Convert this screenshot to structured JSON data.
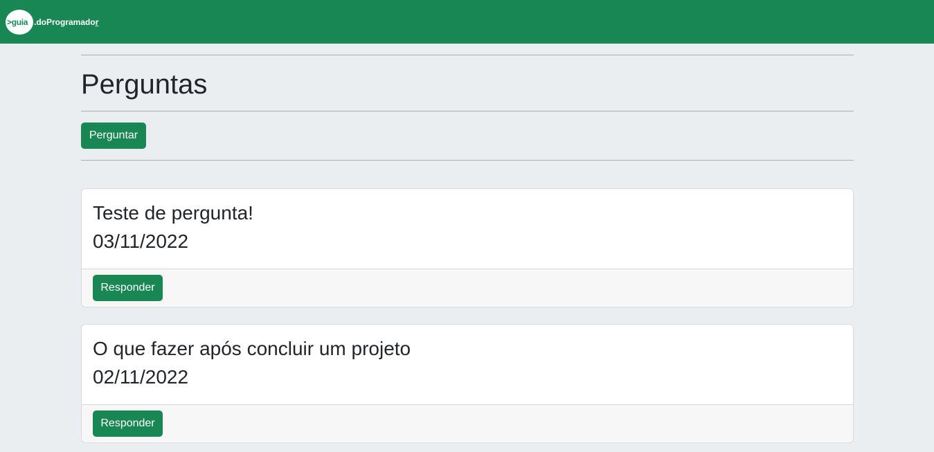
{
  "navbar": {
    "brand_prefix": ">guia",
    "brand_suffix": ".doProgramado",
    "brand_cursor": "r"
  },
  "page": {
    "title": "Perguntas",
    "ask_button_label": "Perguntar"
  },
  "questions": [
    {
      "title": "Teste de pergunta!",
      "date": "03/11/2022",
      "reply_label": "Responder"
    },
    {
      "title": "O que fazer após concluir um projeto",
      "date": "02/11/2022",
      "reply_label": "Responder"
    }
  ],
  "colors": {
    "primary_green": "#198754",
    "page_background": "#eaeef1"
  }
}
